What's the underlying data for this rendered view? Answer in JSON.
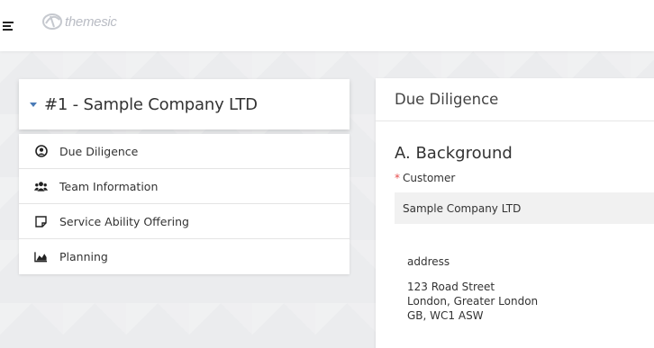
{
  "header": {
    "logo_text": "themesic"
  },
  "company": {
    "title": "#1 - Sample Company LTD"
  },
  "menu": {
    "items": [
      {
        "label": "Due Diligence",
        "icon": "user-circle-icon"
      },
      {
        "label": "Team Information",
        "icon": "users-icon"
      },
      {
        "label": "Service Ability Offering",
        "icon": "sticky-note-icon"
      },
      {
        "label": "Planning",
        "icon": "area-chart-icon"
      }
    ]
  },
  "main": {
    "header_title": "Due Diligence",
    "section_title": "A. Background",
    "customer_label": "Customer",
    "required_mark": "*",
    "customer_value": "Sample Company LTD",
    "address_label": "address",
    "address_lines": [
      "123 Road Street",
      "London, Greater London",
      "GB, WC1 ASW"
    ]
  },
  "colors": {
    "accent": "#4a7bb7",
    "required": "#e64a4a",
    "background": "#ebecee"
  }
}
